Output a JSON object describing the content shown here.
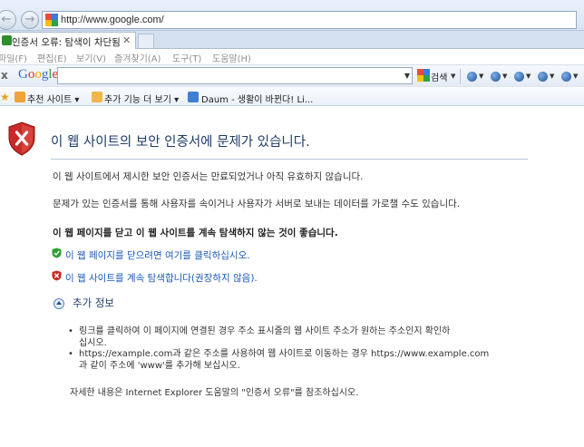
{
  "address": {
    "url": "http://www.google.com/"
  },
  "tab": {
    "title": "인증서 오류: 탐색이 차단됨",
    "close": "✕"
  },
  "menu": [
    "파일(F)",
    "편집(E)",
    "보기(V)",
    "즐겨찾기(A)",
    "도구(T)",
    "도움말(H)"
  ],
  "google_toolbar": {
    "close": "x",
    "logo": "Google",
    "search_label": "검색",
    "search_value": ""
  },
  "favorites": {
    "items": [
      "추천 사이트 ▾",
      "추가 기능 더 보기 ▾",
      "Daum - 생활이 바뀐다! Li..."
    ]
  },
  "page": {
    "title": "이 웹 사이트의 보안 인증서에 문제가 있습니다.",
    "para1": "이 웹 사이트에서 제시한 보안 인증서는 만료되었거나 아직 유효하지 않습니다.",
    "para2": "문제가 있는 인증서를 통해 사용자를 속이거나 사용자가 서버로 보내는 데이터를 가로챌 수도 있습니다.",
    "recommend": "이 웹 페이지를 닫고 이 웹 사이트를 계속 탐색하지 않는 것이 좋습니다.",
    "link_close": "이 웹 페이지를 닫으려면 여기를 클릭하십시오.",
    "link_continue": "이 웹 사이트를 계속 탐색합니다(권장하지 않음).",
    "more_info": "추가 정보",
    "bullet1_l1": "링크를 클릭하여 이 페이지에 연결된 경우 주소 표시줄의 웹 사이트 주소가 원하는 주소인지 확인하",
    "bullet1_l2": "십시오.",
    "bullet2_l1": "https://example.com과 같은 주소를 사용하여 웹 사이트로 이동하는 경우 https://www.example.com",
    "bullet2_l2": "과 같이 주소에 'www'를 추가해 보십시오.",
    "footer": "자세한 내용은 Internet Explorer 도움말의 \"인증서 오류\"를 참조하십시오."
  }
}
